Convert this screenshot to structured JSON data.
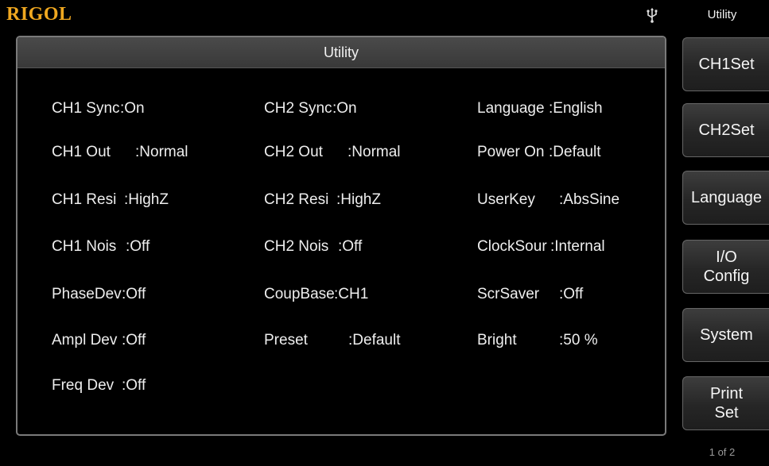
{
  "header": {
    "brand": "RIGOL"
  },
  "panel": {
    "title": "Utility"
  },
  "params": {
    "col1": [
      {
        "name": "CH1 Sync",
        "value": ":On"
      },
      {
        "name": "CH1 Out",
        "value": ":Normal"
      },
      {
        "name": "CH1 Resi",
        "value": ":HighZ"
      },
      {
        "name": "CH1 Nois",
        "value": ":Off"
      },
      {
        "name": "PhaseDev",
        "value": ":Off"
      },
      {
        "name": "Ampl Dev",
        "value": ":Off"
      },
      {
        "name": "Freq Dev",
        "value": ":Off"
      }
    ],
    "col2": [
      {
        "name": "CH2 Sync",
        "value": ":On"
      },
      {
        "name": "CH2 Out",
        "value": ":Normal"
      },
      {
        "name": "CH2 Resi",
        "value": ":HighZ"
      },
      {
        "name": "CH2 Nois",
        "value": ":Off"
      },
      {
        "name": "CoupBase",
        "value": ":CH1"
      },
      {
        "name": "Preset",
        "value": ":Default"
      }
    ],
    "col3": [
      {
        "name": "Language",
        "value": ":English"
      },
      {
        "name": "Power On",
        "value": ":Default"
      },
      {
        "name": "UserKey",
        "value": ":AbsSine"
      },
      {
        "name": "ClockSour",
        "value": ":Internal"
      },
      {
        "name": "ScrSaver",
        "value": ":Off"
      },
      {
        "name": "Bright",
        "value": ":50 %"
      }
    ]
  },
  "softkeys": {
    "menu_title": "Utility",
    "items": [
      {
        "label": "CH1Set"
      },
      {
        "label": "CH2Set"
      },
      {
        "label": "Language"
      },
      {
        "label": "I/O\nConfig"
      },
      {
        "label": "System"
      },
      {
        "label": "Print\nSet"
      }
    ],
    "page_indicator": "1 of 2"
  },
  "icons": {
    "usb": "usb-icon"
  },
  "colors": {
    "brand": "#f0a820",
    "background": "#000000",
    "panel_border": "#7a7a7a"
  }
}
